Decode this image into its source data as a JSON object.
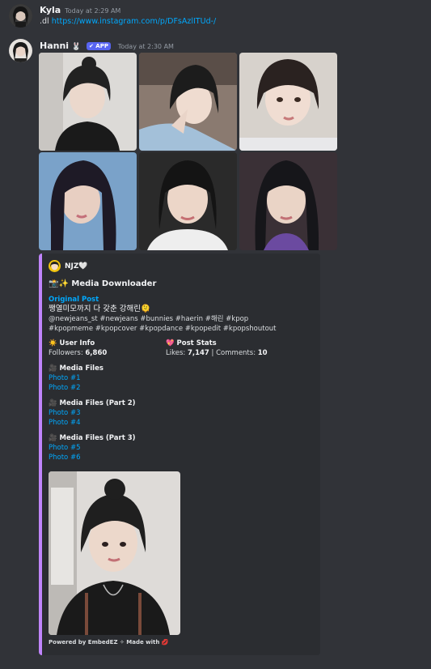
{
  "messages": [
    {
      "author": "Kyla",
      "timestamp": "Today at 2:29 AM",
      "command": ".dl",
      "link": "https://www.instagram.com/p/DFsAzlITUd-/"
    },
    {
      "author": "Hanni",
      "author_emoji": "🐰",
      "badge": "✔ APP",
      "timestamp": "Today at 2:30 AM"
    }
  ],
  "embed": {
    "author": "NJZ🤍",
    "title": "📸✨ Media Downloader",
    "original_post_label": "Original Post",
    "caption": "쨍열미모까지 다 갖춘 강해린🫠",
    "hashtags": "@newjeans_st #newjeans #bunnies #haerin #해린 #kpop #kpopmeme #kpopcover #kpopdance #kpopedit #kpopshoutout",
    "user_info": {
      "title": "☀️ User Info",
      "followers_label": "Followers:",
      "followers_value": "6,860"
    },
    "post_stats": {
      "title": "💖 Post Stats",
      "likes_label": "Likes:",
      "likes_value": "7,147",
      "comments_label": "Comments:",
      "comments_value": "10"
    },
    "media_groups": [
      {
        "title": "🎥 Media Files",
        "links": [
          "Photo #1",
          "Photo #2"
        ]
      },
      {
        "title": "🎥 Media Files (Part 2)",
        "links": [
          "Photo #3",
          "Photo #4"
        ]
      },
      {
        "title": "🎥 Media Files (Part 3)",
        "links": [
          "Photo #5",
          "Photo #6"
        ]
      }
    ],
    "footer": "Powered by EmbedEZ ✧ Made with 💋"
  },
  "colors": {
    "background": "#313338",
    "embed_bg": "#2b2d31",
    "embed_accent": "#c084fc",
    "link": "#00a8fc",
    "badge": "#5865f2"
  }
}
